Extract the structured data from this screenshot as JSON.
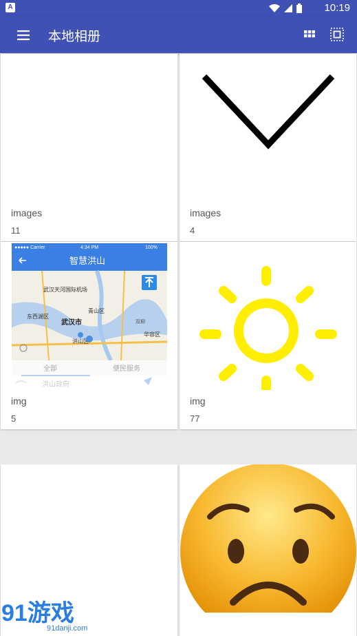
{
  "status": {
    "app_badge": "A",
    "time": "10:19"
  },
  "appbar": {
    "title": "本地相册",
    "menu_icon": "menu-icon",
    "grid_icon": "grid-view-icon",
    "select_icon": "select-all-icon",
    "color": "#3f51b5"
  },
  "albums": [
    {
      "name": "images",
      "count": "11"
    },
    {
      "name": "images",
      "count": "4"
    },
    {
      "name": "img",
      "count": "5"
    },
    {
      "name": "img",
      "count": "77"
    },
    {
      "name": "",
      "count": ""
    },
    {
      "name": "",
      "count": ""
    }
  ],
  "map_preview": {
    "carrier": "●●●●● Carrier",
    "time": "4:34 PM",
    "battery": "100%",
    "title": "智慧洪山",
    "places": [
      "武汉天河国际机场",
      "东西湖区",
      "武汉市",
      "青山区",
      "洪山区",
      "华容区",
      "双柳"
    ],
    "tab_all": "全部",
    "tab_service": "便民服务",
    "row_label": "洪山政府"
  },
  "watermark": {
    "logo": "91游戏",
    "url": "91danji.com"
  }
}
